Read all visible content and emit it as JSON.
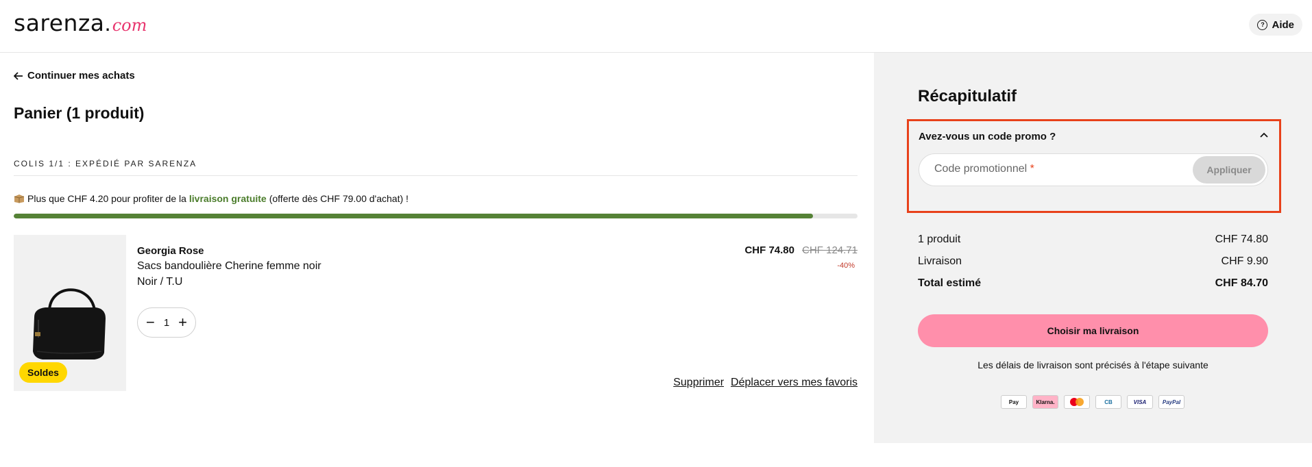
{
  "header": {
    "logo_main": "sarenza",
    "logo_dot": ".",
    "logo_com": "com",
    "help_label": "Aide"
  },
  "cart": {
    "back_label": "Continuer mes achats",
    "title": "Panier (1 produit)",
    "colis_label": "COLIS 1/1 : EXPÉDIÉ PAR SARENZA",
    "ship_msg_pre": "Plus que CHF 4.20 pour profiter de la",
    "ship_msg_link": "livraison gratuite",
    "ship_msg_post": "(offerte dès CHF 79.00 d'achat) !",
    "progress": 0.947,
    "item": {
      "badge": "Soldes",
      "brand": "Georgia Rose",
      "name": "Sacs bandoulière Cherine femme noir",
      "variant": "Noir / T.U",
      "price_now": "CHF 74.80",
      "price_old": "CHF 124.71",
      "discount": "-40%",
      "qty_minus": "−",
      "qty_value": "1",
      "qty_plus": "+",
      "remove_label": "Supprimer",
      "fav_label": "Déplacer vers mes favoris"
    }
  },
  "summary": {
    "title": "Récapitulatif",
    "promo_question": "Avez-vous un code promo ?",
    "promo_placeholder": "Code promotionnel",
    "promo_required": "*",
    "apply_label": "Appliquer",
    "rows": [
      {
        "label": "1 produit",
        "value": "CHF 74.80"
      },
      {
        "label": "Livraison",
        "value": "CHF 9.90"
      },
      {
        "label": "Total estimé",
        "value": "CHF 84.70"
      }
    ],
    "cta_label": "Choisir ma livraison",
    "delay_note": "Les délais de livraison sont précisés à l'étape suivante",
    "payments": [
      "Pay",
      "Klarna.",
      "",
      "CB",
      "VISA",
      "PayPal"
    ]
  },
  "colors": {
    "accent_pink": "#ff8fab",
    "progress_green": "#558236",
    "promo_highlight": "#e8411a",
    "sale_badge": "#ffd700"
  }
}
